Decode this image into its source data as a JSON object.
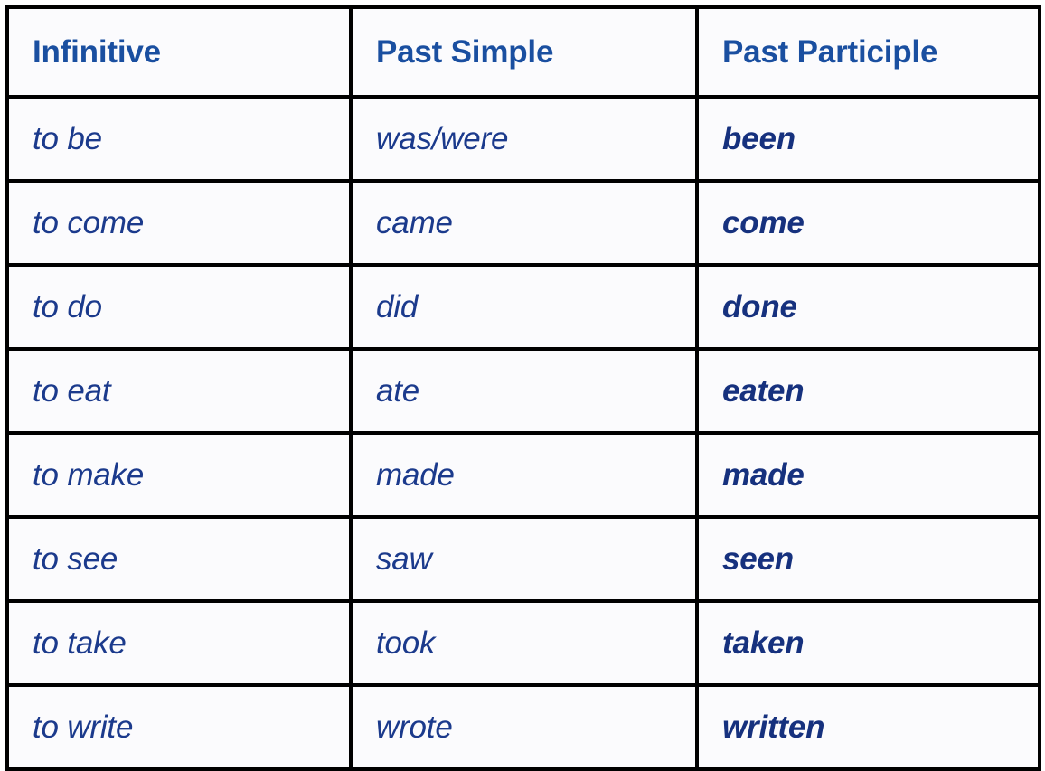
{
  "table": {
    "columns": [
      {
        "key": "infinitive",
        "label": "Infinitive"
      },
      {
        "key": "past_simple",
        "label": "Past Simple"
      },
      {
        "key": "past_participle",
        "label": "Past Participle"
      }
    ],
    "rows": [
      {
        "infinitive": "to be",
        "past_simple": "was/were",
        "past_participle": "been"
      },
      {
        "infinitive": "to come",
        "past_simple": "came",
        "past_participle": "come"
      },
      {
        "infinitive": "to do",
        "past_simple": "did",
        "past_participle": "done"
      },
      {
        "infinitive": "to eat",
        "past_simple": "ate",
        "past_participle": "eaten"
      },
      {
        "infinitive": "to make",
        "past_simple": "made",
        "past_participle": "made"
      },
      {
        "infinitive": "to see",
        "past_simple": "saw",
        "past_participle": "seen"
      },
      {
        "infinitive": "to take",
        "past_simple": "took",
        "past_participle": "taken"
      },
      {
        "infinitive": "to write",
        "past_simple": "wrote",
        "past_participle": "written"
      }
    ]
  },
  "colors": {
    "header_text": "#1a4fa0",
    "body_text": "#1b3a8c",
    "participle_text": "#16317e",
    "border": "#000000",
    "cell_background": "#fbfbfd",
    "page_background": "#ffffff"
  }
}
